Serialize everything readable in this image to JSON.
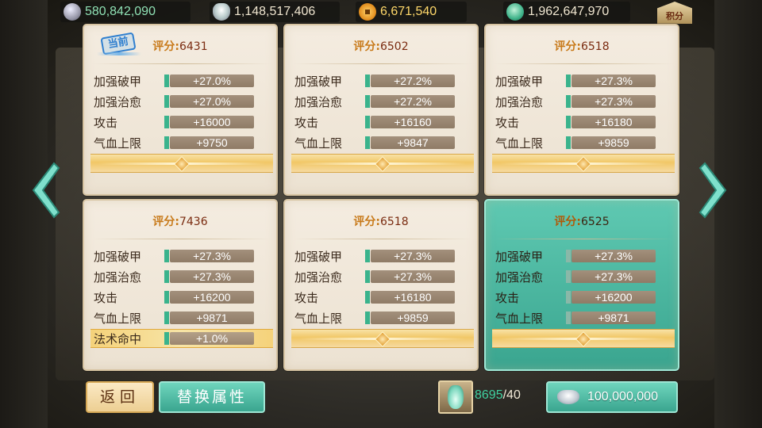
{
  "currencies": [
    {
      "icon": "silver-coin-icon",
      "value": "580,842,090",
      "color": "#8fe0b4"
    },
    {
      "icon": "silver-ingot-icon",
      "value": "1,148,517,406",
      "color": "#f0e6d0"
    },
    {
      "icon": "copper-coin-icon",
      "value": "6,671,540",
      "color": "#ffd86a"
    },
    {
      "icon": "jade-icon",
      "value": "1,962,647,970",
      "color": "#f0e6d0"
    }
  ],
  "score_button": {
    "label": "积分"
  },
  "cards": [
    {
      "current": true,
      "current_label": "当前",
      "score_label": "评分:",
      "score": "6431",
      "attrs": [
        {
          "name": "加强破甲",
          "value": "+27.0%"
        },
        {
          "name": "加强治愈",
          "value": "+27.0%"
        },
        {
          "name": "攻击",
          "value": "+16000"
        },
        {
          "name": "气血上限",
          "value": "+9750"
        }
      ]
    },
    {
      "score_label": "评分:",
      "score": "6502",
      "attrs": [
        {
          "name": "加强破甲",
          "value": "+27.2%"
        },
        {
          "name": "加强治愈",
          "value": "+27.2%"
        },
        {
          "name": "攻击",
          "value": "+16160"
        },
        {
          "name": "气血上限",
          "value": "+9847"
        }
      ]
    },
    {
      "score_label": "评分:",
      "score": "6518",
      "attrs": [
        {
          "name": "加强破甲",
          "value": "+27.3%"
        },
        {
          "name": "加强治愈",
          "value": "+27.3%"
        },
        {
          "name": "攻击",
          "value": "+16180"
        },
        {
          "name": "气血上限",
          "value": "+9859"
        }
      ]
    },
    {
      "score_label": "评分:",
      "score": "7436",
      "attrs": [
        {
          "name": "加强破甲",
          "value": "+27.3%"
        },
        {
          "name": "加强治愈",
          "value": "+27.3%"
        },
        {
          "name": "攻击",
          "value": "+16200"
        },
        {
          "name": "气血上限",
          "value": "+9871"
        },
        {
          "name": "法术命中",
          "value": "+1.0%"
        }
      ]
    },
    {
      "score_label": "评分:",
      "score": "6518",
      "attrs": [
        {
          "name": "加强破甲",
          "value": "+27.3%"
        },
        {
          "name": "加强治愈",
          "value": "+27.3%"
        },
        {
          "name": "攻击",
          "value": "+16180"
        },
        {
          "name": "气血上限",
          "value": "+9859"
        }
      ]
    },
    {
      "selected": true,
      "score_label": "评分:",
      "score": "6525",
      "attrs": [
        {
          "name": "加强破甲",
          "value": "+27.3%"
        },
        {
          "name": "加强治愈",
          "value": "+27.3%"
        },
        {
          "name": "攻击",
          "value": "+16200"
        },
        {
          "name": "气血上限",
          "value": "+9871"
        }
      ]
    }
  ],
  "buttons": {
    "back_label": "返回",
    "replace_label": "替换属性"
  },
  "material": {
    "icon": "vase-icon",
    "have": "8695",
    "separator": "/",
    "need": "40"
  },
  "cost": {
    "icon": "silver-ingot-icon",
    "amount": "100,000,000"
  }
}
